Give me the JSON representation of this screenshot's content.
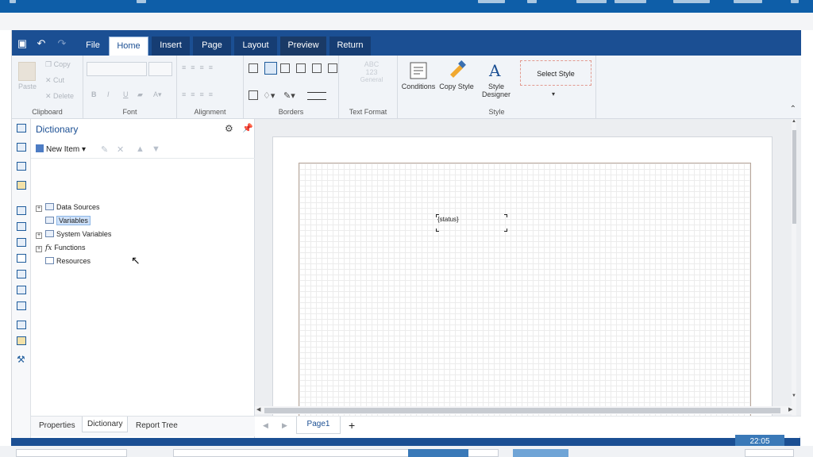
{
  "tabs": {
    "file": "File",
    "home": "Home",
    "insert": "Insert",
    "page": "Page",
    "layout": "Layout",
    "preview": "Preview",
    "return": "Return"
  },
  "ribbon": {
    "clipboard": {
      "paste": "Paste",
      "copy": "Copy",
      "cut": "Cut",
      "delete": "Delete",
      "label": "Clipboard"
    },
    "font": {
      "label": "Font",
      "bold": "B",
      "italic": "I",
      "underline": "U"
    },
    "alignment": {
      "label": "Alignment"
    },
    "borders": {
      "label": "Borders"
    },
    "text_format": {
      "sample_top": "ABC",
      "sample_bottom": "123",
      "general": "General",
      "label": "Text Format"
    },
    "style": {
      "conditions": "Conditions",
      "copy_style": "Copy Style",
      "style_designer_line1": "Style",
      "style_designer_line2": "Designer",
      "select_style": "Select Style",
      "label": "Style"
    }
  },
  "dictionary": {
    "title": "Dictionary",
    "new_item": "New Item",
    "tree": [
      {
        "label": "Data Sources",
        "expandable": true
      },
      {
        "label": "Variables",
        "expandable": false,
        "selected": true
      },
      {
        "label": "System Variables",
        "expandable": true
      },
      {
        "label": "Functions",
        "expandable": true
      },
      {
        "label": "Resources",
        "expandable": false
      }
    ],
    "bottom_tabs": [
      "Properties",
      "Dictionary",
      "Report Tree"
    ]
  },
  "canvas": {
    "field_text": "{status}",
    "page_tab": "Page1",
    "add_page": "+"
  },
  "status": {
    "zoom": "22:05"
  },
  "colors": {
    "accent": "#1b4f93",
    "outer_bar": "#0e5ea8"
  }
}
